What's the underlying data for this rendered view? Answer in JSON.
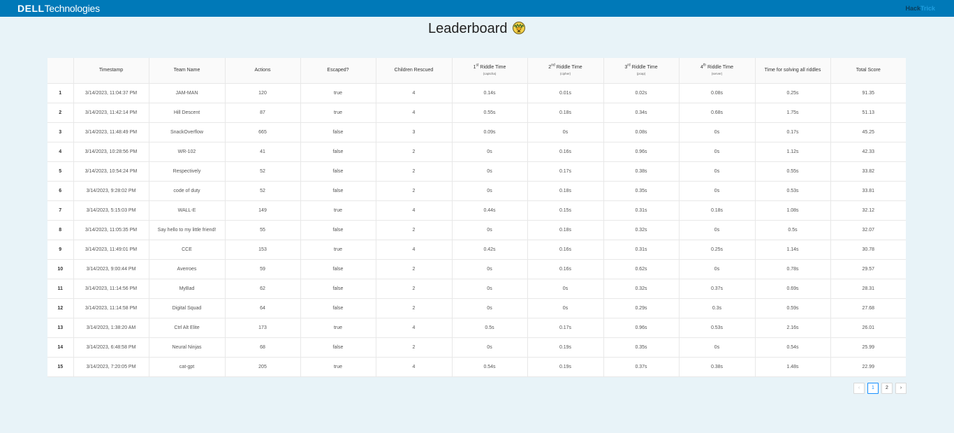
{
  "header": {
    "logo_part1": "DELL",
    "logo_part2": "Technologies",
    "brand_part1": "Hack",
    "brand_part2": "Trick"
  },
  "page": {
    "title": "Leaderboard"
  },
  "table": {
    "columns": {
      "rank": "",
      "timestamp": "Timestamp",
      "team": "Team Name",
      "actions": "Actions",
      "escaped": "Escaped?",
      "children": "Children Rescued",
      "r1_ord": "1",
      "r1_sup": "st",
      "r1_label": "Riddle Time",
      "r1_sub": "(captcha)",
      "r2_ord": "2",
      "r2_sup": "nd",
      "r2_label": "Riddle Time",
      "r2_sub": "(cipher)",
      "r3_ord": "3",
      "r3_sup": "rd",
      "r3_label": "Riddle Time",
      "r3_sub": "(pcap)",
      "r4_ord": "4",
      "r4_sup": "th",
      "r4_label": "Riddle Time",
      "r4_sub": "(server)",
      "all": "Time for solving all riddles",
      "total": "Total Score"
    },
    "rows": [
      {
        "rank": "1",
        "timestamp": "3/14/2023, 11:04:37 PM",
        "team": "JAM-MAN",
        "actions": "120",
        "escaped": "true",
        "children": "4",
        "r1": "0.14s",
        "r2": "0.01s",
        "r3": "0.02s",
        "r4": "0.08s",
        "all": "0.25s",
        "total": "91.35"
      },
      {
        "rank": "2",
        "timestamp": "3/14/2023, 11:42:14 PM",
        "team": "Hill Descent",
        "actions": "87",
        "escaped": "true",
        "children": "4",
        "r1": "0.55s",
        "r2": "0.18s",
        "r3": "0.34s",
        "r4": "0.68s",
        "all": "1.75s",
        "total": "51.13"
      },
      {
        "rank": "3",
        "timestamp": "3/14/2023, 11:48:49 PM",
        "team": "SnackOverflow",
        "actions": "665",
        "escaped": "false",
        "children": "3",
        "r1": "0.09s",
        "r2": "0s",
        "r3": "0.08s",
        "r4": "0s",
        "all": "0.17s",
        "total": "45.25"
      },
      {
        "rank": "4",
        "timestamp": "3/14/2023, 10:28:56 PM",
        "team": "WR-102",
        "actions": "41",
        "escaped": "false",
        "children": "2",
        "r1": "0s",
        "r2": "0.16s",
        "r3": "0.96s",
        "r4": "0s",
        "all": "1.12s",
        "total": "42.33"
      },
      {
        "rank": "5",
        "timestamp": "3/14/2023, 10:54:24 PM",
        "team": "Respectively",
        "actions": "52",
        "escaped": "false",
        "children": "2",
        "r1": "0s",
        "r2": "0.17s",
        "r3": "0.38s",
        "r4": "0s",
        "all": "0.55s",
        "total": "33.82"
      },
      {
        "rank": "6",
        "timestamp": "3/14/2023, 9:28:02 PM",
        "team": "code of duty",
        "actions": "52",
        "escaped": "false",
        "children": "2",
        "r1": "0s",
        "r2": "0.18s",
        "r3": "0.35s",
        "r4": "0s",
        "all": "0.53s",
        "total": "33.81"
      },
      {
        "rank": "7",
        "timestamp": "3/14/2023, 5:15:03 PM",
        "team": "WALL-E",
        "actions": "149",
        "escaped": "true",
        "children": "4",
        "r1": "0.44s",
        "r2": "0.15s",
        "r3": "0.31s",
        "r4": "0.18s",
        "all": "1.08s",
        "total": "32.12"
      },
      {
        "rank": "8",
        "timestamp": "3/14/2023, 11:05:35 PM",
        "team": "Say hello to my little friend!",
        "actions": "55",
        "escaped": "false",
        "children": "2",
        "r1": "0s",
        "r2": "0.18s",
        "r3": "0.32s",
        "r4": "0s",
        "all": "0.5s",
        "total": "32.07"
      },
      {
        "rank": "9",
        "timestamp": "3/14/2023, 11:49:01 PM",
        "team": "CCE",
        "actions": "153",
        "escaped": "true",
        "children": "4",
        "r1": "0.42s",
        "r2": "0.16s",
        "r3": "0.31s",
        "r4": "0.25s",
        "all": "1.14s",
        "total": "30.78"
      },
      {
        "rank": "10",
        "timestamp": "3/14/2023, 9:00:44 PM",
        "team": "Averroes",
        "actions": "59",
        "escaped": "false",
        "children": "2",
        "r1": "0s",
        "r2": "0.16s",
        "r3": "0.62s",
        "r4": "0s",
        "all": "0.78s",
        "total": "29.57"
      },
      {
        "rank": "11",
        "timestamp": "3/14/2023, 11:14:56 PM",
        "team": "MyBad",
        "actions": "62",
        "escaped": "false",
        "children": "2",
        "r1": "0s",
        "r2": "0s",
        "r3": "0.32s",
        "r4": "0.37s",
        "all": "0.69s",
        "total": "28.31"
      },
      {
        "rank": "12",
        "timestamp": "3/14/2023, 11:14:58 PM",
        "team": "Digital Squad",
        "actions": "64",
        "escaped": "false",
        "children": "2",
        "r1": "0s",
        "r2": "0s",
        "r3": "0.29s",
        "r4": "0.3s",
        "all": "0.59s",
        "total": "27.68"
      },
      {
        "rank": "13",
        "timestamp": "3/14/2023, 1:38:20 AM",
        "team": "Ctrl Alt Elite",
        "actions": "173",
        "escaped": "true",
        "children": "4",
        "r1": "0.5s",
        "r2": "0.17s",
        "r3": "0.96s",
        "r4": "0.53s",
        "all": "2.16s",
        "total": "26.01"
      },
      {
        "rank": "14",
        "timestamp": "3/14/2023, 6:48:58 PM",
        "team": "Neural Ninjas",
        "actions": "68",
        "escaped": "false",
        "children": "2",
        "r1": "0s",
        "r2": "0.19s",
        "r3": "0.35s",
        "r4": "0s",
        "all": "0.54s",
        "total": "25.99"
      },
      {
        "rank": "15",
        "timestamp": "3/14/2023, 7:20:05 PM",
        "team": "cat-gpt",
        "actions": "205",
        "escaped": "true",
        "children": "4",
        "r1": "0.54s",
        "r2": "0.19s",
        "r3": "0.37s",
        "r4": "0.38s",
        "all": "1.48s",
        "total": "22.99"
      }
    ]
  },
  "pagination": {
    "prev": "‹",
    "next": "›",
    "pages": [
      "1",
      "2"
    ],
    "current": "1"
  },
  "colors": {
    "topbar": "#0079b8",
    "background": "#e8f3f8",
    "accent": "#1890ff"
  },
  "icons": {
    "trophy": "trophy-icon",
    "prev": "chevron-left-icon",
    "next": "chevron-right-icon"
  }
}
